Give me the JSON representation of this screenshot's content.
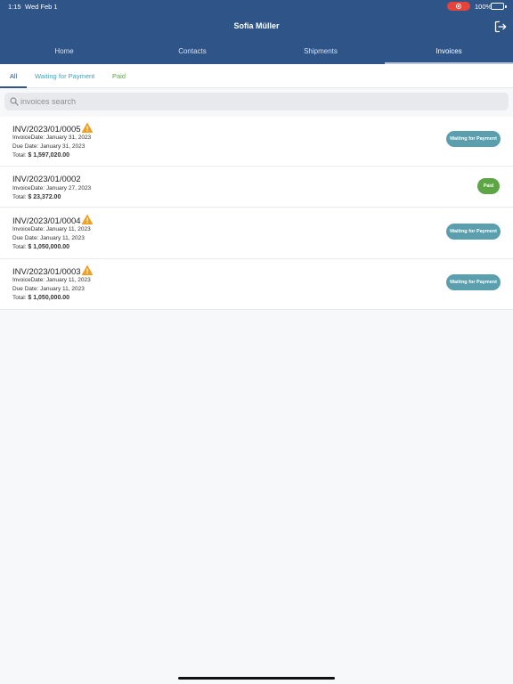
{
  "status_bar": {
    "time": "1:15",
    "date": "Wed Feb 1",
    "battery": "100%"
  },
  "header": {
    "title": "Sofia Müller"
  },
  "tabs": [
    {
      "label": "Home"
    },
    {
      "label": "Contacts"
    },
    {
      "label": "Shipments"
    },
    {
      "label": "Invoices"
    }
  ],
  "filters": {
    "all": "All",
    "waiting": "Waiting for Payment",
    "paid": "Paid"
  },
  "search": {
    "placeholder": "invoices search"
  },
  "invoices": [
    {
      "number": "INV/2023/01/0005",
      "invoice_date": "InvoiceDate: January 31, 2023",
      "due_date": "Due Date: January 31, 2023",
      "total_label": "Total:",
      "total": "$ 1,597,020.00",
      "status": "Waiting for Payment"
    },
    {
      "number": "INV/2023/01/0002",
      "invoice_date": "InvoiceDate: January 27, 2023",
      "total_label": "Total:",
      "total": "$ 23,372.00",
      "status": "Paid"
    },
    {
      "number": "INV/2023/01/0004",
      "invoice_date": "InvoiceDate: January 11, 2023",
      "due_date": "Due Date: January 11, 2023",
      "total_label": "Total:",
      "total": "$ 1,050,000.00",
      "status": "Waiting for Payment"
    },
    {
      "number": "INV/2023/01/0003",
      "invoice_date": "InvoiceDate: January 11, 2023",
      "due_date": "Due Date: January 11, 2023",
      "total_label": "Total:",
      "total": "$ 1,050,000.00",
      "status": "Waiting for Payment"
    }
  ],
  "colors": {
    "header": "#2f5487",
    "waiting": "#5b9fae",
    "paid": "#5ea645",
    "warning": "#f0a020"
  }
}
